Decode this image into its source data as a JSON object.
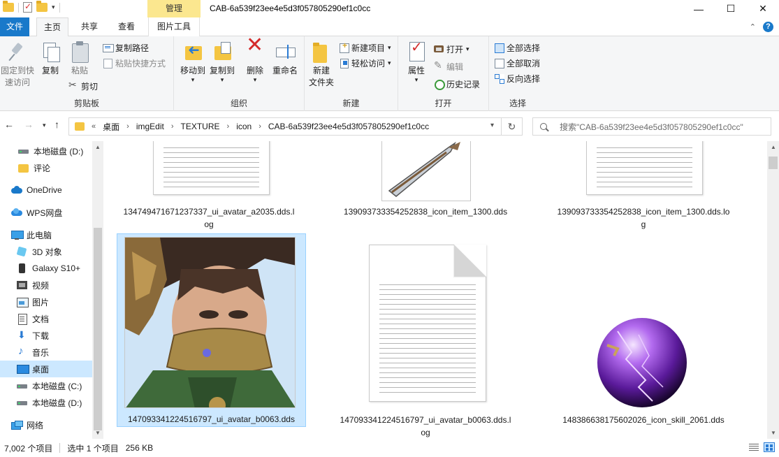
{
  "titlebar": {
    "manage_tab": "管理",
    "title": "CAB-6a539f23ee4e5d3f057805290ef1c0cc",
    "minimize": "—",
    "maximize": "☐",
    "close": "✕"
  },
  "ribbon_tabs": {
    "file": "文件",
    "home": "主页",
    "share": "共享",
    "view": "查看",
    "picture_tools": "图片工具",
    "help": "?"
  },
  "ribbon": {
    "clipboard": {
      "label": "剪贴板",
      "pin_line1": "固定到快",
      "pin_line2": "速访问",
      "copy": "复制",
      "paste": "粘贴",
      "copy_path": "复制路径",
      "paste_shortcut": "粘贴快捷方式",
      "cut": "剪切"
    },
    "organize": {
      "label": "组织",
      "move_to": "移动到",
      "copy_to": "复制到",
      "delete": "删除",
      "rename": "重命名"
    },
    "new": {
      "label": "新建",
      "new_folder_line1": "新建",
      "new_folder_line2": "文件夹",
      "new_item": "新建项目",
      "easy_access": "轻松访问"
    },
    "open": {
      "label": "打开",
      "properties": "属性",
      "open": "打开",
      "edit": "编辑",
      "history": "历史记录"
    },
    "select": {
      "label": "选择",
      "select_all": "全部选择",
      "select_none": "全部取消",
      "invert": "反向选择"
    }
  },
  "address": {
    "prefix": "«",
    "crumbs": [
      "桌面",
      "imgEdit",
      "TEXTURE",
      "icon",
      "CAB-6a539f23ee4e5d3f057805290ef1c0cc"
    ],
    "search_placeholder": "搜索\"CAB-6a539f23ee4e5d3f057805290ef1c0cc\""
  },
  "nav_pane": {
    "items": [
      {
        "label": "本地磁盘 (D:)",
        "icon": "drive-icon"
      },
      {
        "label": "评论",
        "icon": "folder-icon"
      },
      {
        "label": "OneDrive",
        "icon": "onedrive-icon"
      },
      {
        "label": "WPS网盘",
        "icon": "wps-cloud-icon"
      },
      {
        "label": "此电脑",
        "icon": "pc-icon"
      },
      {
        "label": "3D 对象",
        "icon": "3d-objects-icon"
      },
      {
        "label": "Galaxy S10+",
        "icon": "phone-icon"
      },
      {
        "label": "视频",
        "icon": "video-icon"
      },
      {
        "label": "图片",
        "icon": "pictures-icon"
      },
      {
        "label": "文档",
        "icon": "documents-icon"
      },
      {
        "label": "下载",
        "icon": "downloads-icon"
      },
      {
        "label": "音乐",
        "icon": "music-icon"
      },
      {
        "label": "桌面",
        "icon": "desktop-icon"
      },
      {
        "label": "本地磁盘 (C:)",
        "icon": "drive-icon"
      },
      {
        "label": "本地磁盘 (D:)",
        "icon": "drive-icon"
      },
      {
        "label": "网络",
        "icon": "network-icon"
      }
    ],
    "selected_index": 12
  },
  "files": [
    {
      "name": "134749471671237337_ui_avatar_a2035.dds.log",
      "line1": "134749471671237337_ui_avatar_a2035.dds.l",
      "line2": "og",
      "kind": "log"
    },
    {
      "name": "139093733354252838_icon_item_1300.dds",
      "line1": "139093733354252838_icon_item_1300.dds",
      "line2": "",
      "kind": "image-sword"
    },
    {
      "name": "139093733354252838_icon_item_1300.dds.log",
      "line1": "139093733354252838_icon_item_1300.dds.lo",
      "line2": "g",
      "kind": "log"
    },
    {
      "name": "147093341224516797_ui_avatar_b0063.dds",
      "line1": "147093341224516797_ui_avatar_b0063.dds",
      "line2": "",
      "kind": "image-avatar",
      "selected": true
    },
    {
      "name": "147093341224516797_ui_avatar_b0063.dds.log",
      "line1": "147093341224516797_ui_avatar_b0063.dds.l",
      "line2": "og",
      "kind": "log"
    },
    {
      "name": "148386638175602026_icon_skill_2061.dds",
      "line1": "148386638175602026_icon_skill_2061.dds",
      "line2": "",
      "kind": "image-skill"
    }
  ],
  "status": {
    "count": "7,002 个项目",
    "selected": "选中 1 个项目",
    "size": "256 KB"
  }
}
